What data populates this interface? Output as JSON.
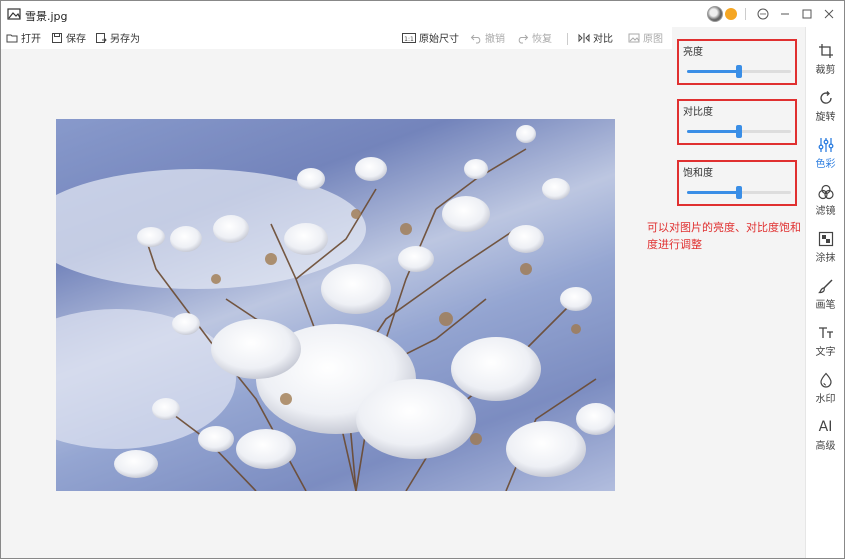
{
  "window": {
    "title": "雪景.jpg"
  },
  "toolbar": {
    "open": "打开",
    "save": "保存",
    "save_as": "另存为",
    "original_size": "原始尺寸",
    "undo": "撤销",
    "redo": "恢复",
    "compare": "对比",
    "original_image": "原图"
  },
  "adjust": {
    "brightness": {
      "label": "亮度",
      "value": 0.5
    },
    "contrast": {
      "label": "对比度",
      "value": 0.5
    },
    "saturation": {
      "label": "饱和度",
      "value": 0.5
    },
    "accent_color": "#3a8ee6"
  },
  "annotation": {
    "text": "可以对图片的亮度、对比度饱和度进行调整",
    "color": "#e03030"
  },
  "sidebar": {
    "items": [
      {
        "label": "裁剪",
        "icon": "crop-icon"
      },
      {
        "label": "旋转",
        "icon": "rotate-icon"
      },
      {
        "label": "色彩",
        "icon": "color-adjust-icon"
      },
      {
        "label": "滤镜",
        "icon": "filter-icon"
      },
      {
        "label": "涂抹",
        "icon": "mosaic-icon"
      },
      {
        "label": "画笔",
        "icon": "brush-icon"
      },
      {
        "label": "文字",
        "icon": "text-icon"
      },
      {
        "label": "水印",
        "icon": "watermark-icon"
      },
      {
        "label": "高级",
        "icon": "ai-icon"
      }
    ]
  }
}
